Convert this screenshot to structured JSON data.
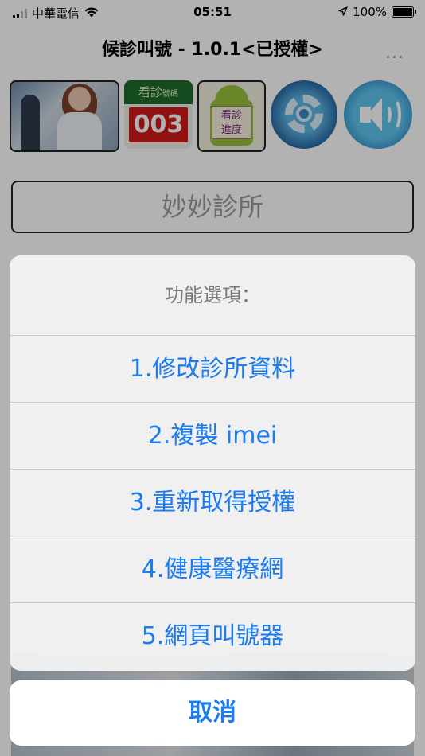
{
  "status_bar": {
    "carrier": "中華電信",
    "time": "05:51",
    "battery_pct": "100%",
    "icons": [
      "signal-icon",
      "wifi-icon",
      "location-arrow-icon",
      "battery-icon"
    ]
  },
  "app": {
    "title": "候診叫號 - 1.0.1<已授權>",
    "more_label": "...",
    "clinic_name": "妙妙診所",
    "toolbar": {
      "number_label": "看診",
      "number_sub": "號碼",
      "number_value": "003",
      "progress_label_1": "看診",
      "progress_label_2": "進度",
      "icons": [
        "nurse-photo-icon",
        "queue-number-icon",
        "android-progress-icon",
        "gear-icon",
        "speaker-icon"
      ]
    }
  },
  "action_sheet": {
    "header": "功能選項：",
    "options": [
      "1.修改診所資料",
      "2.複製 imei",
      "3.重新取得授權",
      "4.健康醫療網",
      "5.網頁叫號器"
    ],
    "cancel_label": "取消"
  },
  "colors": {
    "accent": "#1a7cf0",
    "number_red": "#d21b1b",
    "header_grey": "#7a7a7a"
  }
}
